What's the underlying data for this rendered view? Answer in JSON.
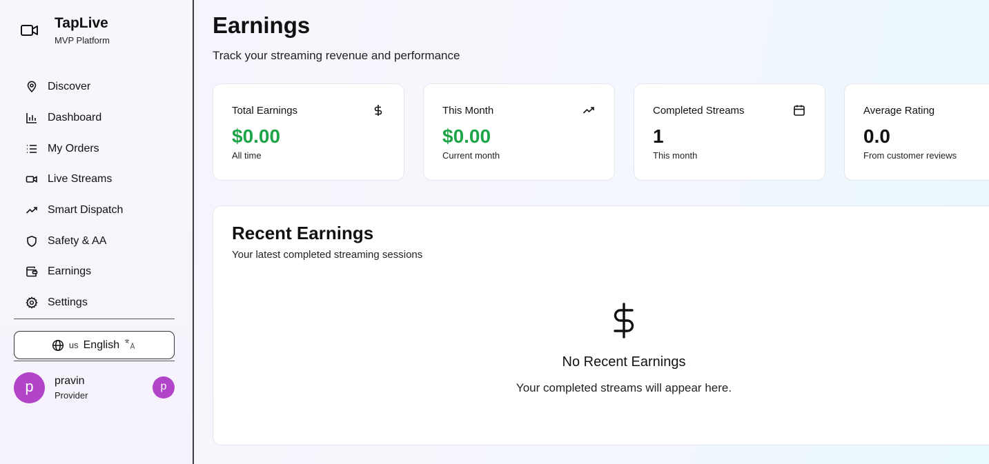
{
  "brand": {
    "title": "TapLive",
    "subtitle": "MVP Platform",
    "icon": "video-camera-icon"
  },
  "sidebar": {
    "items": [
      {
        "label": "Discover",
        "icon": "map-pin-icon"
      },
      {
        "label": "Dashboard",
        "icon": "bar-chart-icon"
      },
      {
        "label": "My Orders",
        "icon": "list-icon"
      },
      {
        "label": "Live Streams",
        "icon": "video-icon"
      },
      {
        "label": "Smart Dispatch",
        "icon": "trending-up-icon"
      },
      {
        "label": "Safety & AA",
        "icon": "shield-icon"
      },
      {
        "label": "Earnings",
        "icon": "wallet-icon"
      },
      {
        "label": "Settings",
        "icon": "gear-icon"
      }
    ],
    "language": {
      "country": "us",
      "label": "English"
    },
    "user": {
      "initial": "p",
      "name": "pravin",
      "role": "Provider"
    }
  },
  "header": {
    "title": "Earnings",
    "subtitle": "Track your streaming revenue and performance"
  },
  "stats": [
    {
      "title": "Total Earnings",
      "value": "$0.00",
      "note": "All time",
      "icon": "dollar-icon",
      "accent": "#1fa44a"
    },
    {
      "title": "This Month",
      "value": "$0.00",
      "note": "Current month",
      "icon": "trending-up-icon",
      "accent": "#1fa44a"
    },
    {
      "title": "Completed Streams",
      "value": "1",
      "note": "This month",
      "icon": "calendar-icon",
      "accent": "#111111"
    },
    {
      "title": "Average Rating",
      "value": "0.0",
      "note": "From customer reviews",
      "icon": "star-icon",
      "accent": "#111111"
    }
  ],
  "recent": {
    "title": "Recent Earnings",
    "subtitle": "Your latest completed streaming sessions",
    "empty_icon": "$",
    "empty_title": "No Recent Earnings",
    "empty_text": "Your completed streams will appear here."
  }
}
